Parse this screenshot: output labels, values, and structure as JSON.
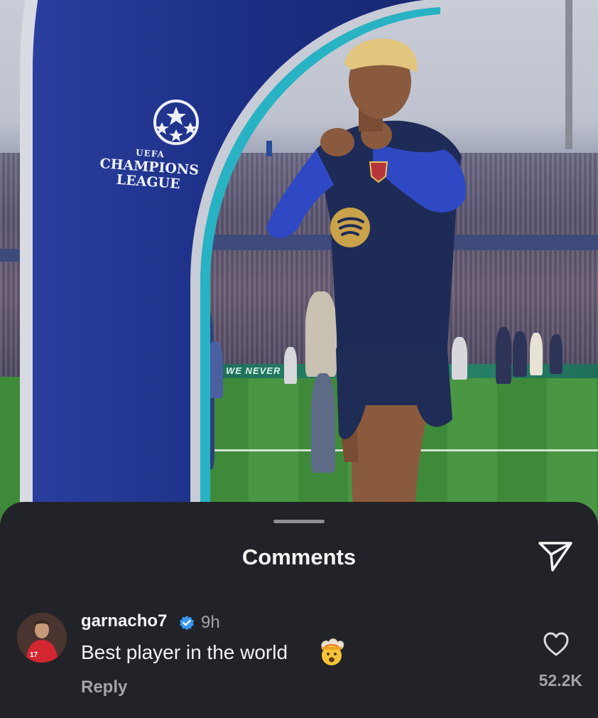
{
  "post": {
    "arch_logo": {
      "uefa": "UEFA",
      "line1": "CHAMPIONS",
      "line2": "LEAGUE"
    },
    "adboard_text": "WE NEVER F"
  },
  "comments_sheet": {
    "title": "Comments",
    "share_icon": "paper-plane-icon",
    "comments": [
      {
        "username": "garnacho7",
        "verified": true,
        "time": "9h",
        "text": "Best player in the world",
        "emoji": "exploding-head-emoji",
        "reply_label": "Reply",
        "likes": "52.2K",
        "like_icon": "heart-outline-icon"
      }
    ]
  },
  "colors": {
    "sheet_bg": "#212328",
    "verified_blue": "#3897f0",
    "muted_text": "#a3a5ab",
    "arch_blue": "#1c2f86"
  }
}
